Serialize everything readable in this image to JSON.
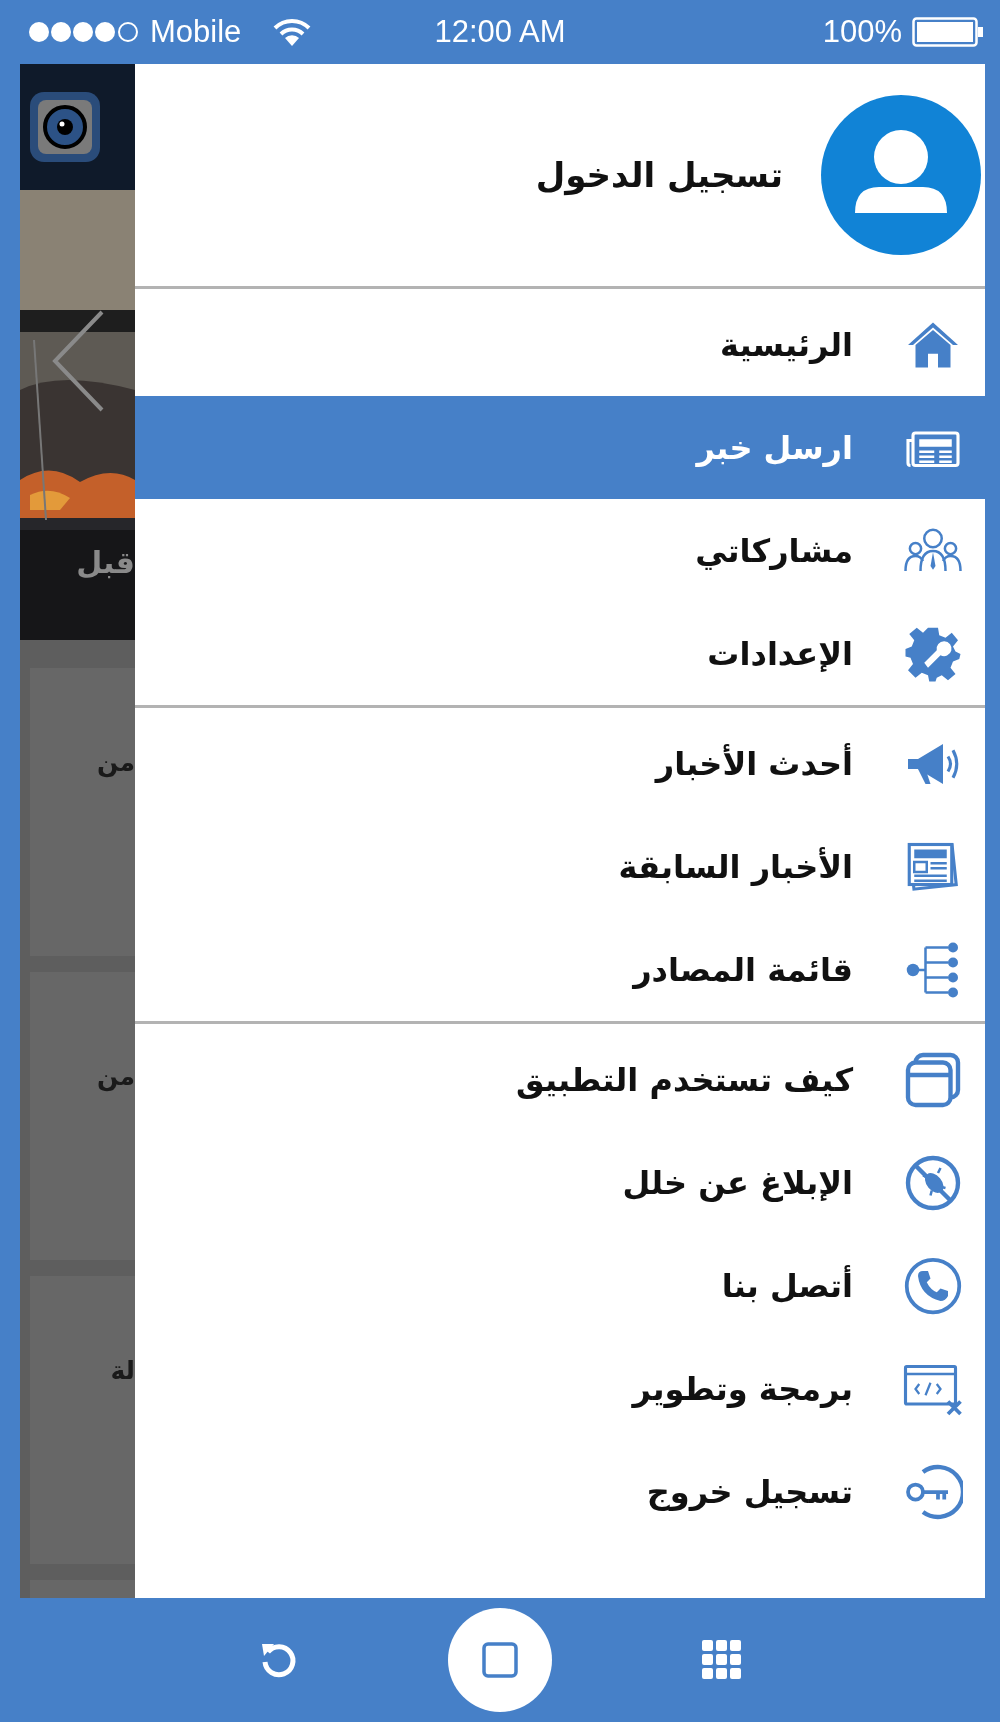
{
  "status_bar": {
    "carrier": "Mobile",
    "time": "12:00 AM",
    "battery": "100%"
  },
  "background_app": {
    "slide_caption": "قبل",
    "cards": [
      {
        "text": "من"
      },
      {
        "text": "من"
      },
      {
        "text": "لة"
      }
    ]
  },
  "drawer": {
    "login": "تسجيل الدخول",
    "sections": [
      {
        "items": [
          {
            "label": "الرئيسية",
            "kind": "home",
            "selected": false
          },
          {
            "label": "ارسل خبر",
            "kind": "newspaper",
            "selected": true
          },
          {
            "label": "مشاركاتي",
            "kind": "people",
            "selected": false
          },
          {
            "label": "الإعدادات",
            "kind": "settings",
            "selected": false
          }
        ]
      },
      {
        "items": [
          {
            "label": "أحدث الأخبار",
            "kind": "megaphone",
            "selected": false
          },
          {
            "label": "الأخبار السابقة",
            "kind": "news",
            "selected": false
          },
          {
            "label": "قائمة المصادر",
            "kind": "sources",
            "selected": false
          }
        ]
      },
      {
        "items": [
          {
            "label": "كيف تستخدم التطبيق",
            "kind": "window",
            "selected": false
          },
          {
            "label": "الإبلاغ عن خلل",
            "kind": "bug",
            "selected": false
          },
          {
            "label": "أتصل بنا",
            "kind": "phone",
            "selected": false
          },
          {
            "label": "برمجة وتطوير",
            "kind": "code",
            "selected": false
          },
          {
            "label": "تسجيل خروج",
            "kind": "logout",
            "selected": false
          }
        ]
      }
    ]
  }
}
